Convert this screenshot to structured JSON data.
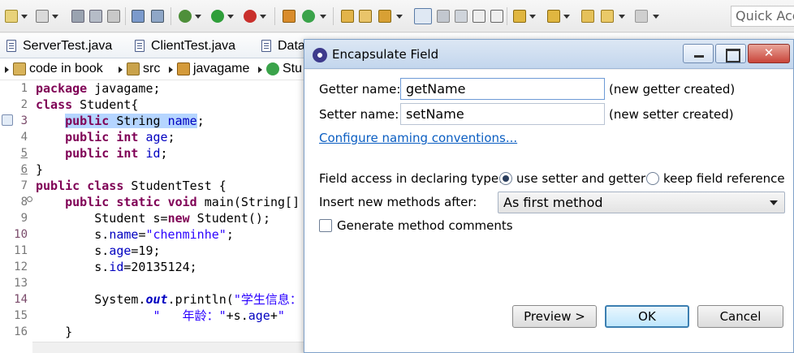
{
  "toolbar": {
    "quick_access_placeholder": "Quick Acc"
  },
  "tabs": [
    {
      "label": "ServerTest.java"
    },
    {
      "label": "ClientTest.java"
    },
    {
      "label": "Data"
    }
  ],
  "breadcrumb": [
    {
      "label": "code in book"
    },
    {
      "label": "src"
    },
    {
      "label": "javagame"
    },
    {
      "label": "Stu"
    }
  ],
  "editor": {
    "line_numbers": [
      "1",
      "2",
      "3",
      "4",
      "5",
      "6",
      "7",
      "8",
      "9",
      "10",
      "11",
      "12",
      "13",
      "14",
      "15",
      "16"
    ]
  },
  "dialog": {
    "title": "Encapsulate Field",
    "close_glyph": "✕",
    "getter_label": "Getter name:",
    "getter_value": "getName",
    "getter_note": "(new getter created)",
    "setter_label": "Setter name:",
    "setter_value": "setName",
    "setter_note": "(new setter created)",
    "configure_link": "Configure naming conventions...",
    "field_access_label": "Field access in declaring type:",
    "option_setter_getter": "use setter and getter",
    "option_keep_ref": "keep field reference",
    "insert_after_label": "Insert new methods after:",
    "insert_after_value": "As first method",
    "generate_comments": "Generate method comments",
    "preview_button": "Preview >",
    "ok_button": "OK",
    "cancel_button": "Cancel"
  },
  "colors": {
    "keyword": "#7f0055",
    "string": "#2a00ff",
    "field": "#0000c0",
    "selection": "#b5d5ff",
    "link": "#0b5ec2"
  }
}
